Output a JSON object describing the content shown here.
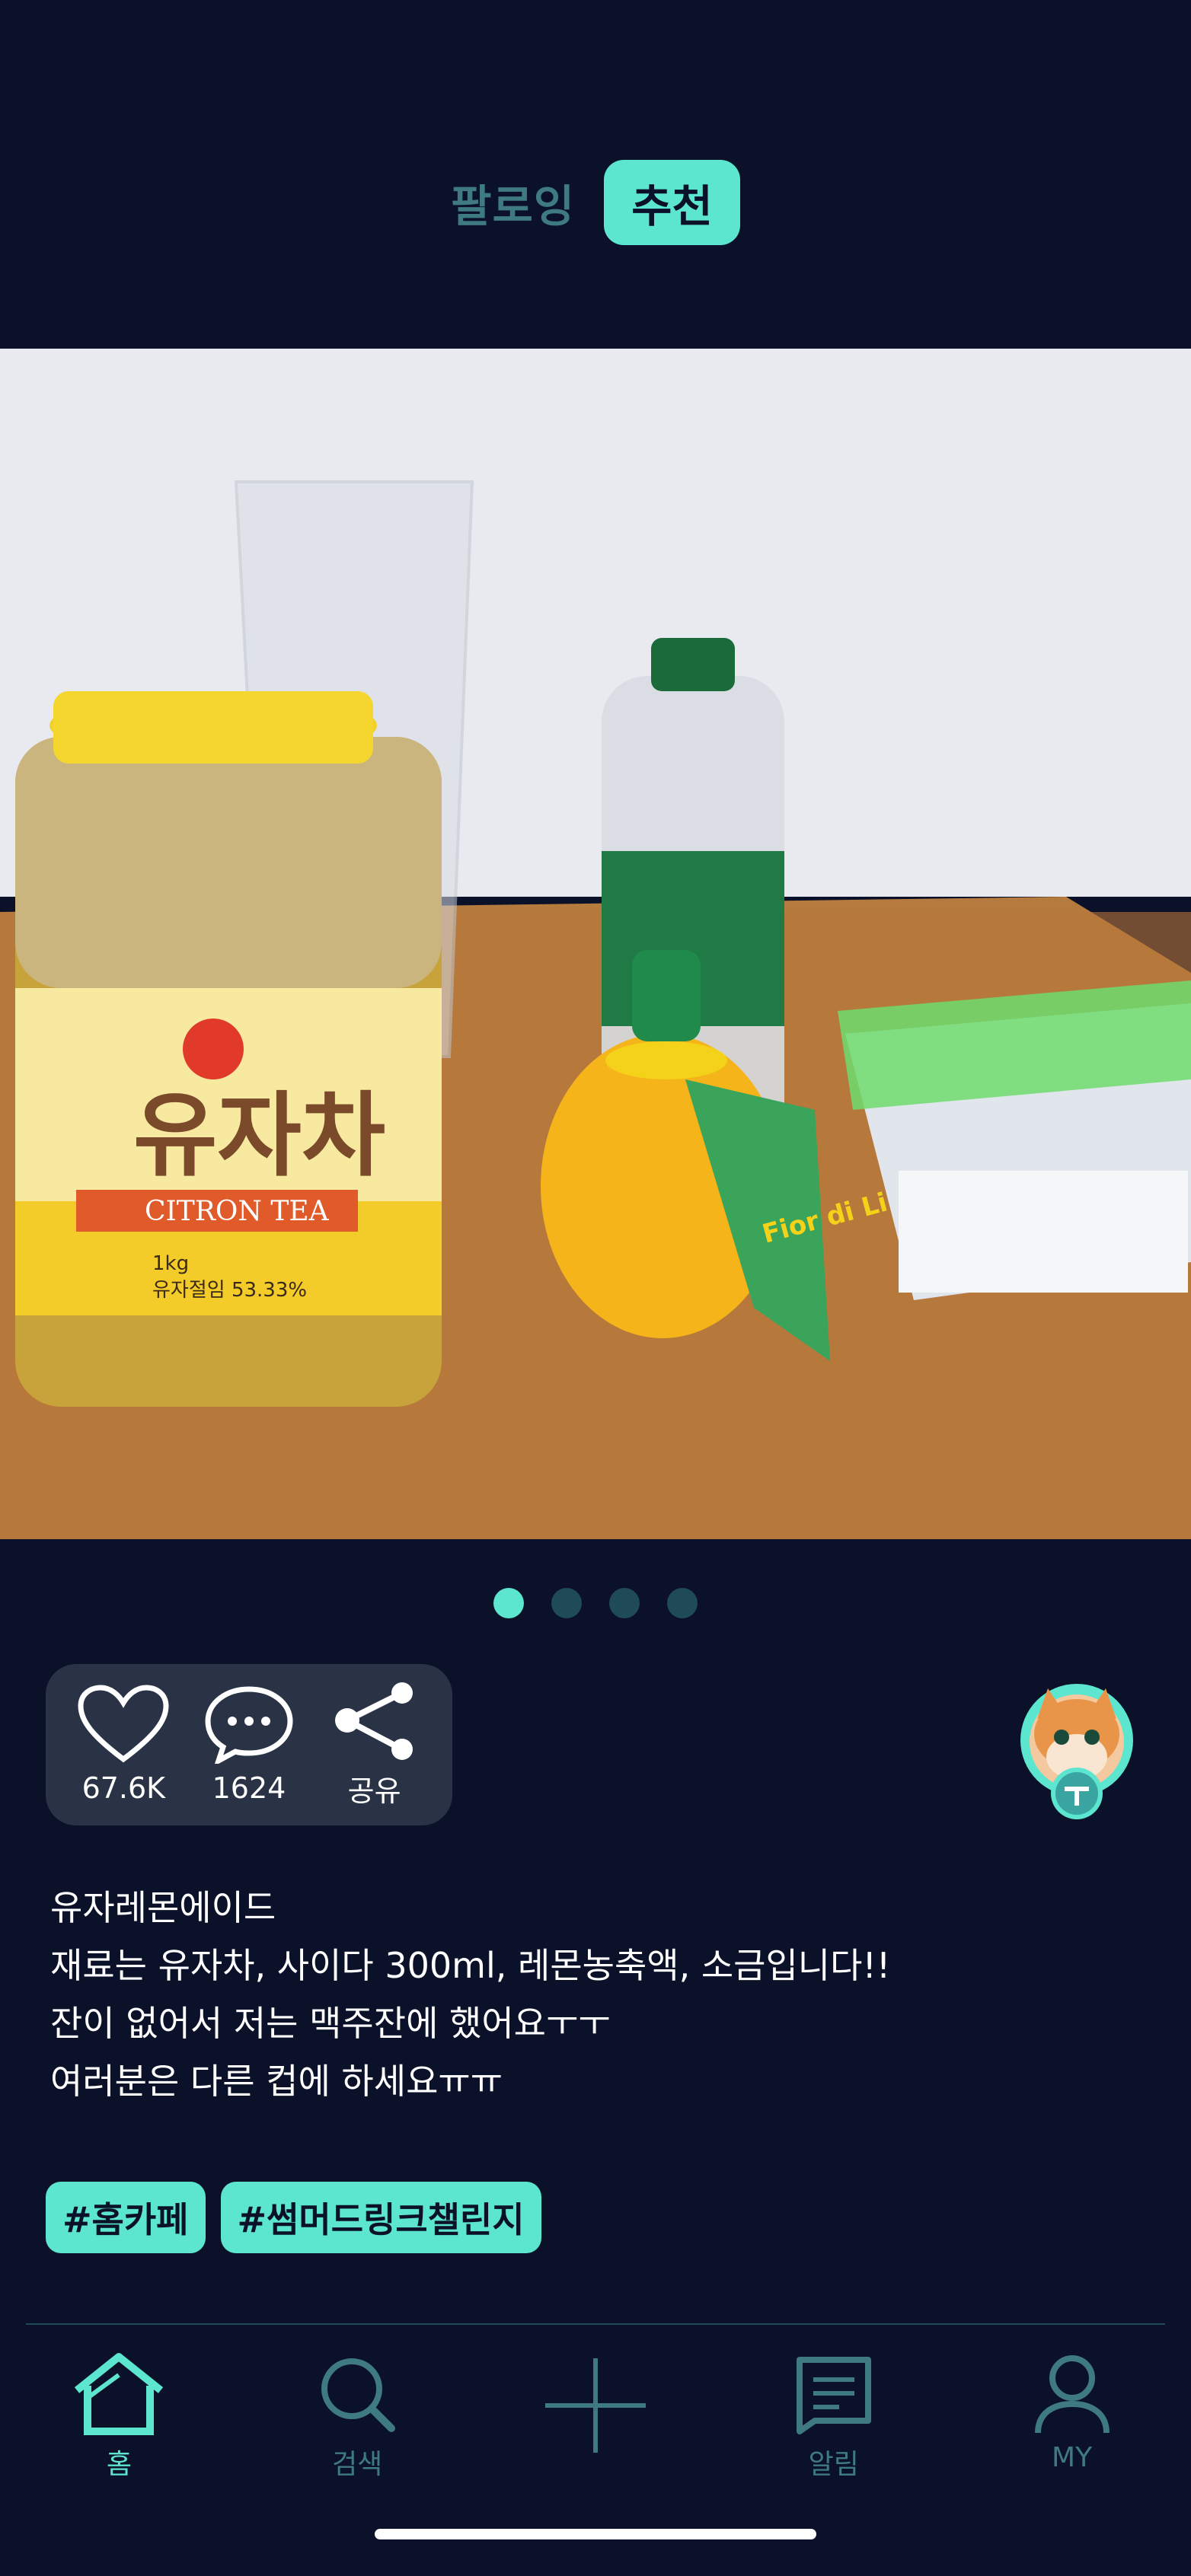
{
  "tabs": {
    "following": "팔로잉",
    "recommend": "추천"
  },
  "post": {
    "pagination": {
      "total": 4,
      "current": 1
    },
    "actions": {
      "likes": "67.6K",
      "comments": "1624",
      "share": "공유"
    },
    "caption_lines": [
      "유자레몬에이드",
      "재료는 유자차, 사이다 300ml, 레몬농축액, 소금입니다!!",
      "잔이 없어서 저는 맥주잔에 했어요ㅜㅜ",
      "여러분은 다른 컵에 하세요ㅠㅠ"
    ],
    "hashtags": [
      "#홈카페",
      "#썸머드링크챌린지"
    ],
    "photo_labels": {
      "jar_brand": "유자차",
      "jar_sub": "CITRON TEA",
      "jar_weight": "1kg",
      "jar_pct": "유자절임 53.33%",
      "lemon_brand": "Fior di Limone"
    }
  },
  "nav": {
    "home": "홈",
    "search": "검색",
    "notifications": "알림",
    "my": "MY"
  },
  "colors": {
    "background": "#0a1128",
    "accent": "#5ce6d0",
    "muted": "#3e7a80"
  }
}
